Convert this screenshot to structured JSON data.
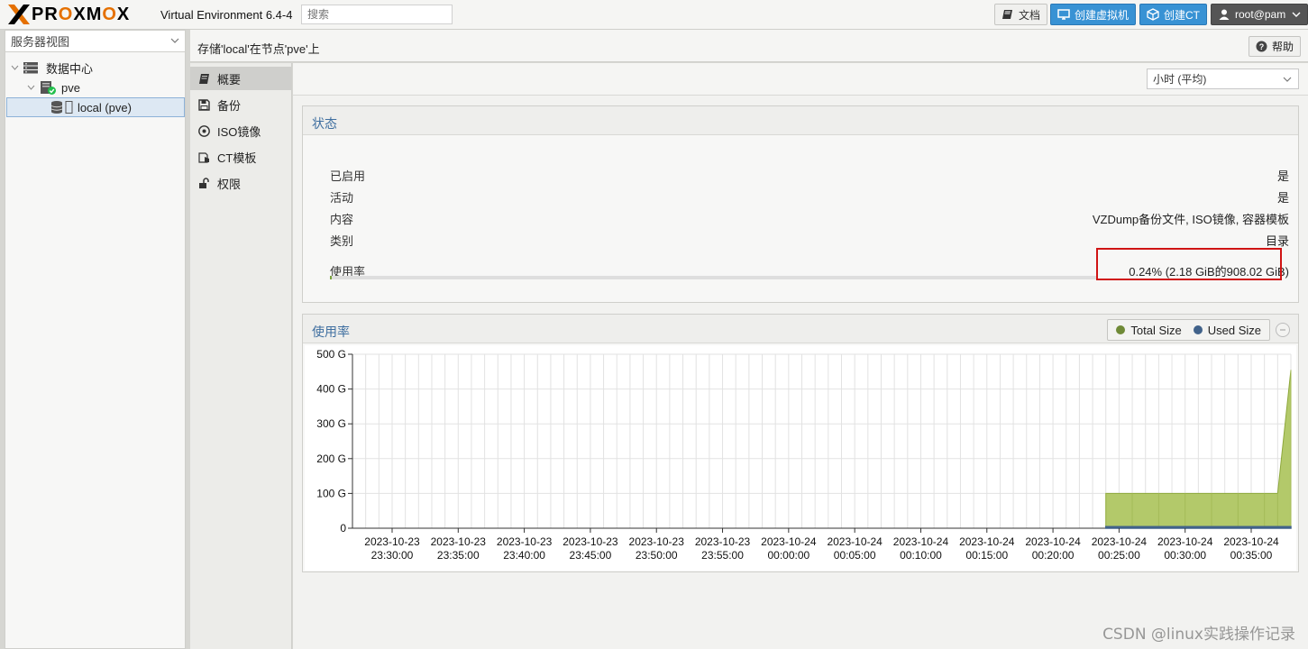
{
  "app": {
    "logo_text_1": "PR",
    "logo_text_o1": "O",
    "logo_text_2": "XM",
    "logo_text_o2": "O",
    "logo_text_3": "X",
    "version": "Virtual Environment 6.4-4",
    "search_placeholder": "搜索"
  },
  "topbar": {
    "docs": "文档",
    "create_vm": "创建虚拟机",
    "create_ct": "创建CT",
    "user": "root@pam"
  },
  "tree": {
    "view": "服务器视图",
    "datacenter": "数据中心",
    "node": "pve",
    "storage": "local (pve)"
  },
  "header": {
    "title": "存储'local'在节点'pve'上",
    "help": "帮助"
  },
  "nav": {
    "items": [
      {
        "label": "概要",
        "icon": "book-icon"
      },
      {
        "label": "备份",
        "icon": "floppy-icon"
      },
      {
        "label": "ISO镜像",
        "icon": "disc-icon"
      },
      {
        "label": "CT模板",
        "icon": "template-icon"
      },
      {
        "label": "权限",
        "icon": "unlock-icon"
      }
    ]
  },
  "toolbar": {
    "timeframe": "小时 (平均)"
  },
  "status": {
    "title": "状态",
    "rows": [
      {
        "key": "已启用",
        "value": "是"
      },
      {
        "key": "活动",
        "value": "是"
      },
      {
        "key": "内容",
        "value": "VZDump备份文件, ISO镜像, 容器模板"
      },
      {
        "key": "类别",
        "value": "目录"
      }
    ],
    "usage_label": "使用率",
    "usage_value": "0.24% (2.18 GiB的908.02 GiB)",
    "usage_fraction": 0.0024
  },
  "usage_panel": {
    "title": "使用率",
    "legend_total": "Total Size",
    "legend_used": "Used Size"
  },
  "colors": {
    "total": "#b3c96a",
    "total_line": "#8ea83c",
    "used": "#41628a",
    "accent": "#3892d4"
  },
  "chart_data": {
    "type": "area",
    "y_ticks": [
      "0",
      "100 G",
      "200 G",
      "300 G",
      "400 G",
      "500 G"
    ],
    "ylim": [
      0,
      500
    ],
    "x_ticks": [
      [
        "2023-10-23",
        "23:30:00"
      ],
      [
        "2023-10-23",
        "23:35:00"
      ],
      [
        "2023-10-23",
        "23:40:00"
      ],
      [
        "2023-10-23",
        "23:45:00"
      ],
      [
        "2023-10-23",
        "23:50:00"
      ],
      [
        "2023-10-23",
        "23:55:00"
      ],
      [
        "2023-10-24",
        "00:00:00"
      ],
      [
        "2023-10-24",
        "00:05:00"
      ],
      [
        "2023-10-24",
        "00:10:00"
      ],
      [
        "2023-10-24",
        "00:15:00"
      ],
      [
        "2023-10-24",
        "00:20:00"
      ],
      [
        "2023-10-24",
        "00:25:00"
      ],
      [
        "2023-10-24",
        "00:30:00"
      ],
      [
        "2023-10-24",
        "00:35:00"
      ]
    ],
    "xlim": [
      "2023-10-23 23:27",
      "2023-10-24 00:38"
    ],
    "series": [
      {
        "name": "Total Size",
        "points": [
          [
            "2023-10-24 00:24",
            100
          ],
          [
            "2023-10-24 00:26",
            100
          ],
          [
            "2023-10-24 00:28",
            100
          ],
          [
            "2023-10-24 00:30",
            100
          ],
          [
            "2023-10-24 00:32",
            100
          ],
          [
            "2023-10-24 00:34",
            100
          ],
          [
            "2023-10-24 00:36",
            100
          ],
          [
            "2023-10-24 00:37",
            100
          ],
          [
            "2023-10-24 00:38",
            455
          ]
        ]
      },
      {
        "name": "Used Size",
        "points": [
          [
            "2023-10-24 00:24",
            2
          ],
          [
            "2023-10-24 00:38",
            2
          ]
        ]
      }
    ]
  },
  "watermark": "CSDN @linux实践操作记录"
}
